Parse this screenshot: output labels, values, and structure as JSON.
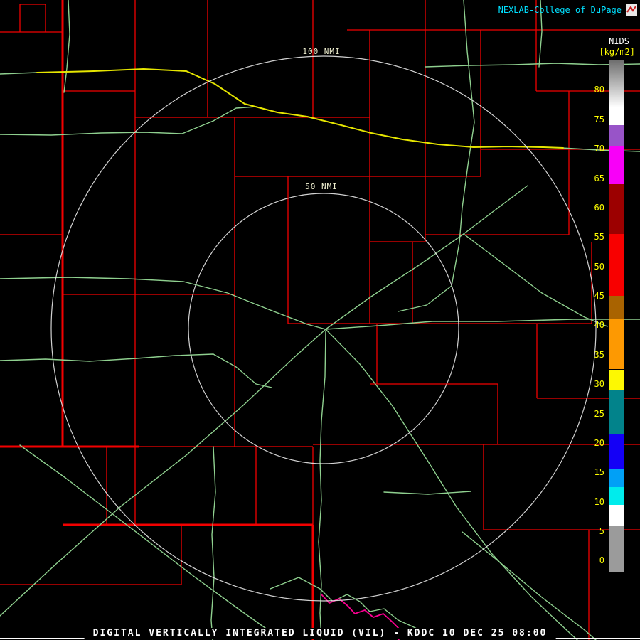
{
  "branding": {
    "text": "NEXLAB-College of DuPage"
  },
  "colorbar": {
    "title": "NIDS",
    "units": "[kg/m2]",
    "ticks": [
      80,
      75,
      70,
      65,
      60,
      55,
      50,
      45,
      40,
      35,
      30,
      25,
      20,
      15,
      10,
      5,
      0
    ],
    "value_min": -2,
    "value_max": 85,
    "segments": [
      {
        "from": 77,
        "to": 85,
        "color": "#ffffff",
        "gradient_top": "#6f6f6f"
      },
      {
        "from": 74,
        "to": 77,
        "color": "#ffffff"
      },
      {
        "from": 70.5,
        "to": 74,
        "color": "#9854c8"
      },
      {
        "from": 64,
        "to": 70.5,
        "color": "#f800f8"
      },
      {
        "from": 55.5,
        "to": 64,
        "color": "#9c0000"
      },
      {
        "from": 45,
        "to": 55.5,
        "color": "#f80000"
      },
      {
        "from": 41,
        "to": 45,
        "color": "#a96300"
      },
      {
        "from": 32.5,
        "to": 41,
        "color": "#fd9902"
      },
      {
        "from": 29,
        "to": 32.5,
        "color": "#fdf802"
      },
      {
        "from": 21.5,
        "to": 29,
        "color": "#02838b"
      },
      {
        "from": 15.5,
        "to": 21.5,
        "color": "#1400f6"
      },
      {
        "from": 12.5,
        "to": 15.5,
        "color": "#01a0f6"
      },
      {
        "from": 9.5,
        "to": 12.5,
        "color": "#00ecec"
      },
      {
        "from": 6,
        "to": 9.5,
        "color": "#ffffff"
      },
      {
        "from": -2,
        "to": 6,
        "color": "#9b9b9b"
      }
    ]
  },
  "rings": {
    "outer_label": "100 NMI",
    "inner_label": "50 NMI"
  },
  "footer": {
    "title": "DIGITAL VERTICALLY INTEGRATED LIQUID (VIL) - KDDC 10 DEC 25 08:00"
  },
  "map": {
    "colors": {
      "county": "#f20000",
      "road": "#8fd08f",
      "highway": "#e6e600",
      "river": "#fa0090",
      "ring": "#e9e9e9",
      "ring_label": "#f0f0d0",
      "branding": "#00e0ff",
      "tick_text": "#ffff00",
      "footer_text": "#ffffff"
    }
  }
}
